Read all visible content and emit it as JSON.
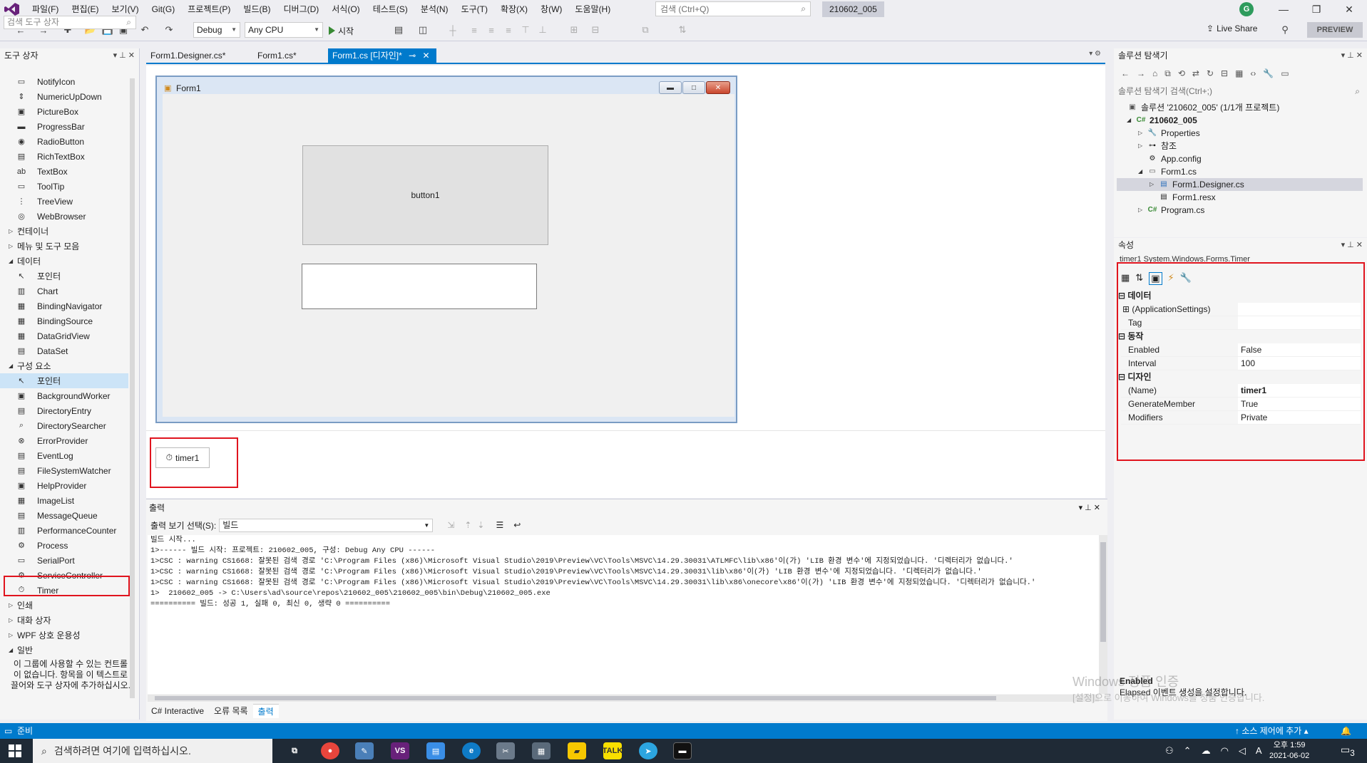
{
  "menu": {
    "items": [
      "파일(F)",
      "편집(E)",
      "보기(V)",
      "Git(G)",
      "프로젝트(P)",
      "빌드(B)",
      "디버그(D)",
      "서식(O)",
      "테스트(S)",
      "분석(N)",
      "도구(T)",
      "확장(X)",
      "창(W)",
      "도움말(H)"
    ],
    "search_placeholder": "검색 (Ctrl+Q)",
    "solution_name": "210602_005"
  },
  "toolbar": {
    "config": "Debug",
    "platform": "Any CPU",
    "start_label": "시작",
    "live_share": "Live Share",
    "preview": "PREVIEW"
  },
  "toolbox": {
    "title": "도구 상자",
    "search_placeholder": "검색 도구 상자",
    "top_items": [
      "NotifyIcon",
      "NumericUpDown",
      "PictureBox",
      "ProgressBar",
      "RadioButton",
      "RichTextBox",
      "TextBox",
      "ToolTip",
      "TreeView",
      "WebBrowser"
    ],
    "cat_container": "컨테이너",
    "cat_menus": "메뉴 및 도구 모음",
    "cat_data": "데이터",
    "data_items": [
      "포인터",
      "Chart",
      "BindingNavigator",
      "BindingSource",
      "DataGridView",
      "DataSet"
    ],
    "cat_components": "구성 요소",
    "component_items": [
      "포인터",
      "BackgroundWorker",
      "DirectoryEntry",
      "DirectorySearcher",
      "ErrorProvider",
      "EventLog",
      "FileSystemWatcher",
      "HelpProvider",
      "ImageList",
      "MessageQueue",
      "PerformanceCounter",
      "Process",
      "SerialPort",
      "ServiceController",
      "Timer"
    ],
    "cat_print": "인쇄",
    "cat_dialogs": "대화 상자",
    "cat_wpf": "WPF 상호 운용성",
    "cat_general": "일반",
    "empty_message": "이 그룹에 사용할 수 있는 컨트롤이 없습니다. 항목을 이 텍스트로 끌어와 도구 상자에 추가하십시오."
  },
  "tabs": [
    "Form1.Designer.cs*",
    "Form1.cs*",
    "Form1.cs [디자인]*"
  ],
  "designer": {
    "form_title": "Form1",
    "button_label": "button1",
    "tray_component": "timer1"
  },
  "output": {
    "title": "출력",
    "show_from_label": "출력 보기 선택(S):",
    "show_from_value": "빌드",
    "lines": [
      "빌드 시작...",
      "1>------ 빌드 시작: 프로젝트: 210602_005, 구성: Debug Any CPU ------",
      "1>CSC : warning CS1668: 잘못된 검색 경로 'C:\\Program Files (x86)\\Microsoft Visual Studio\\2019\\Preview\\VC\\Tools\\MSVC\\14.29.30031\\ATLMFC\\lib\\x86'이(가) 'LIB 환경 변수'에 지정되었습니다. '디렉터리가 없습니다.'",
      "1>CSC : warning CS1668: 잘못된 검색 경로 'C:\\Program Files (x86)\\Microsoft Visual Studio\\2019\\Preview\\VC\\Tools\\MSVC\\14.29.30031\\lib\\x86'이(가) 'LIB 환경 변수'에 지정되었습니다. '디렉터리가 없습니다.'",
      "1>CSC : warning CS1668: 잘못된 검색 경로 'C:\\Program Files (x86)\\Microsoft Visual Studio\\2019\\Preview\\VC\\Tools\\MSVC\\14.29.30031\\lib\\x86\\onecore\\x86'이(가) 'LIB 환경 변수'에 지정되었습니다. '디렉터리가 없습니다.'",
      "1>  210602_005 -> C:\\Users\\ad\\source\\repos\\210602_005\\210602_005\\bin\\Debug\\210602_005.exe",
      "========== 빌드: 성공 1, 실패 0, 최신 0, 생략 0 =========="
    ],
    "bottom_tabs": [
      "C# Interactive",
      "오류 목록",
      "출력"
    ]
  },
  "solution_explorer": {
    "title": "솔루션 탐색기",
    "search_placeholder": "솔루션 탐색기 검색(Ctrl+;)",
    "solution": "솔루션 '210602_005' (1/1개 프로젝트)",
    "project": "210602_005",
    "properties": "Properties",
    "references": "참조",
    "app_config": "App.config",
    "form1_cs": "Form1.cs",
    "form1_designer": "Form1.Designer.cs",
    "form1_resx": "Form1.resx",
    "program_cs": "Program.cs"
  },
  "properties": {
    "title": "속성",
    "object": "timer1 System.Windows.Forms.Timer",
    "cat_data": "데이터",
    "app_settings": "(ApplicationSettings)",
    "tag": "Tag",
    "cat_behavior": "동작",
    "enabled_name": "Enabled",
    "enabled_value": "False",
    "interval_name": "Interval",
    "interval_value": "100",
    "cat_design": "디자인",
    "name_name": "(Name)",
    "name_value": "timer1",
    "genmember_name": "GenerateMember",
    "genmember_value": "True",
    "modifiers_name": "Modifiers",
    "modifiers_value": "Private",
    "desc_title": "Enabled",
    "desc_text": "Elapsed 이벤트 생성을 설정합니다."
  },
  "watermark": {
    "line1": "Windows 정품 인증",
    "line2": "[설정]으로 이동하여 Windows를 정품 인증합니다."
  },
  "status": {
    "ready": "준비",
    "source_control": "소스 제어에 추가"
  },
  "taskbar": {
    "search_placeholder": "검색하려면 여기에 입력하십시오.",
    "time": "오후 1:59",
    "date": "2021-06-02",
    "notifications": "3"
  },
  "colors": {
    "accent": "#007acc",
    "highlight": "#e0141e",
    "taskbar": "#1f2a36"
  }
}
